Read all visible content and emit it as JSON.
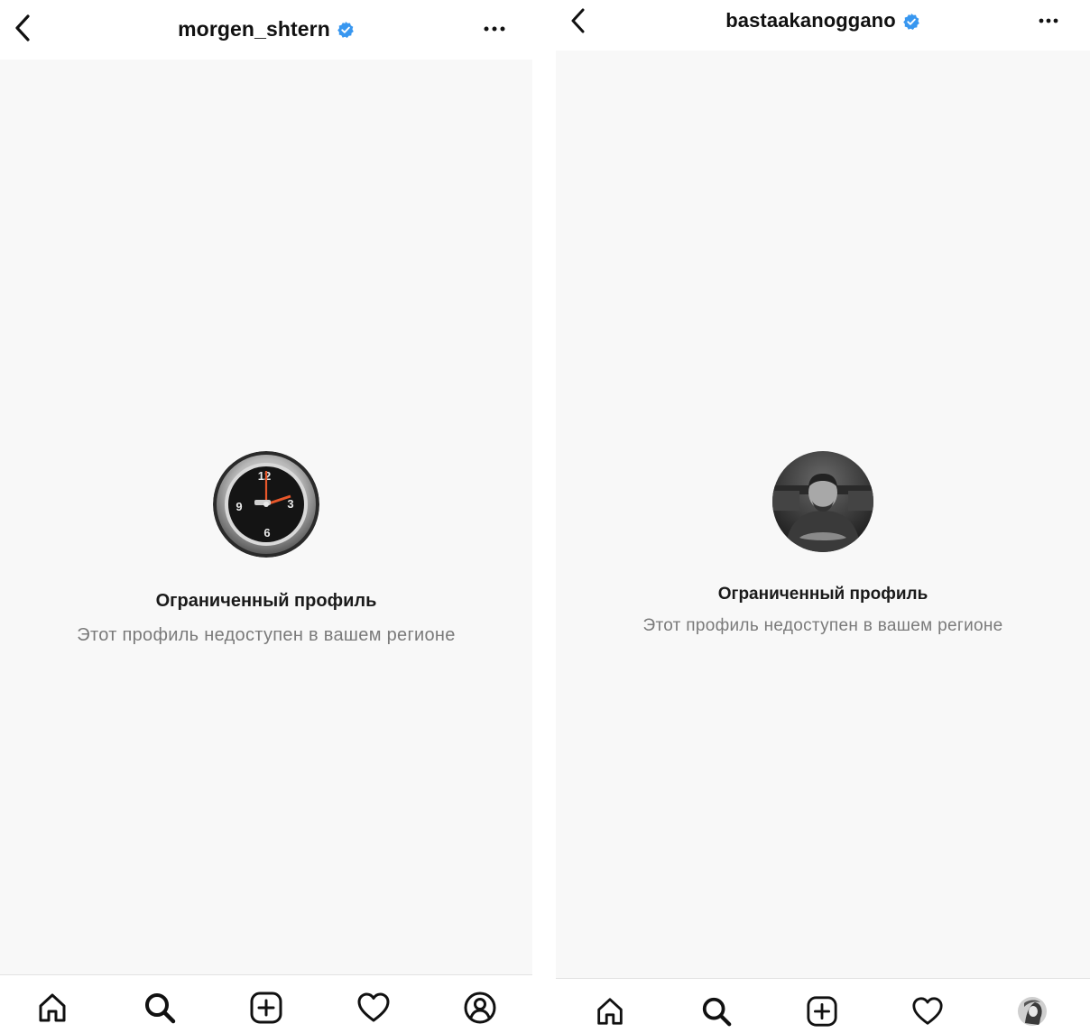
{
  "screens": [
    {
      "username": "morgen_shtern",
      "verified_icon": "verified-badge-icon",
      "avatar_icon": "clock-avatar",
      "restricted_title": "Ограниченный профиль",
      "restricted_message": "Этот профиль недоступен в вашем регионе",
      "tabs": [
        "home-icon",
        "search-icon",
        "new-post-icon",
        "heart-icon",
        "profile-icon"
      ]
    },
    {
      "username": "bastaakanoggano",
      "verified_icon": "verified-badge-icon",
      "avatar_icon": "person-photo-avatar",
      "restricted_title": "Ограниченный профиль",
      "restricted_message": "Этот профиль недоступен в вашем регионе",
      "tabs": [
        "home-icon",
        "search-icon",
        "new-post-icon",
        "heart-icon",
        "user-avatar-icon"
      ]
    }
  ],
  "colors": {
    "verified_blue": "#3897f0",
    "content_bg": "#f8f8f8",
    "text_primary": "#1a1a1a",
    "text_secondary": "#7a7a7a"
  }
}
